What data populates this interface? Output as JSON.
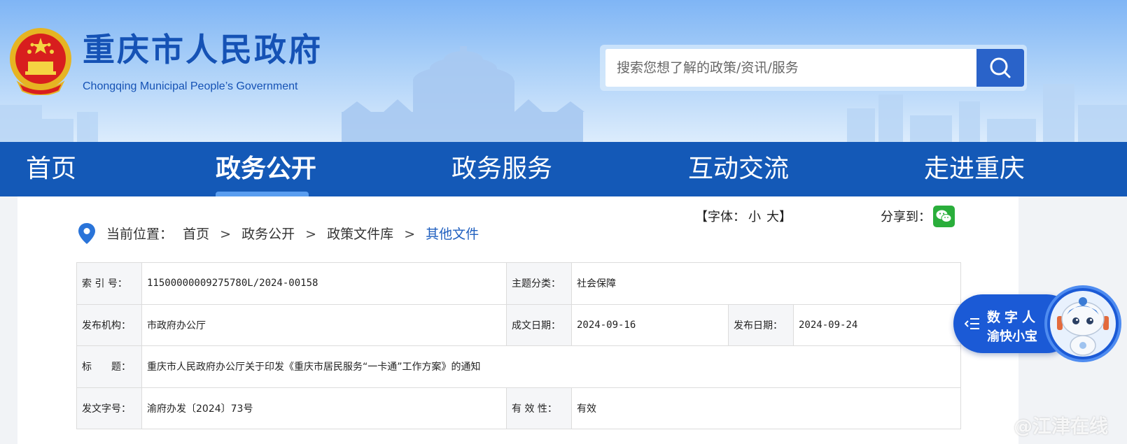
{
  "header": {
    "site_title": "重庆市人民政府",
    "site_subtitle": "Chongqing Municipal People’s Government",
    "search_placeholder": "搜索您想了解的政策/资讯/服务"
  },
  "nav": {
    "items": [
      {
        "label": "首页",
        "active": false
      },
      {
        "label": "政务公开",
        "active": true
      },
      {
        "label": "政务服务",
        "active": false
      },
      {
        "label": "互动交流",
        "active": false
      },
      {
        "label": "走进重庆",
        "active": false
      }
    ]
  },
  "breadcrumb": {
    "prefix": "当前位置：",
    "items": [
      "首页",
      "政务公开",
      "政策文件库",
      "其他文件"
    ],
    "separator": ">"
  },
  "font_size": {
    "open": "【字体：",
    "small": "小",
    "large": "大",
    "close": "】"
  },
  "share": {
    "label": "分享到："
  },
  "info": {
    "index_label": "索 引 号：",
    "index_value": "11500000009275780L/2024-00158",
    "topic_label": "主题分类：",
    "topic_value": "社会保障",
    "issuer_label": "发布机构：",
    "issuer_value": "市政府办公厅",
    "created_label": "成文日期：",
    "created_value": "2024-09-16",
    "published_label": "发布日期：",
    "published_value": "2024-09-24",
    "title_label": "标　　题：",
    "title_value": "重庆市人民政府办公厅关于印发《重庆市居民服务“一卡通”工作方案》的通知",
    "docno_label": "发文字号：",
    "docno_value": "渝府办发〔2024〕73号",
    "validity_label": "有 效 性：",
    "validity_value": "有效"
  },
  "assistant": {
    "line1": "数字人",
    "line2": "渝快小宝"
  },
  "watermark": "@江津在线",
  "colors": {
    "nav_bg": "#1459b7",
    "brand_blue": "#1552b5",
    "link_blue": "#1f5fbf",
    "wechat_green": "#2aae3b"
  }
}
